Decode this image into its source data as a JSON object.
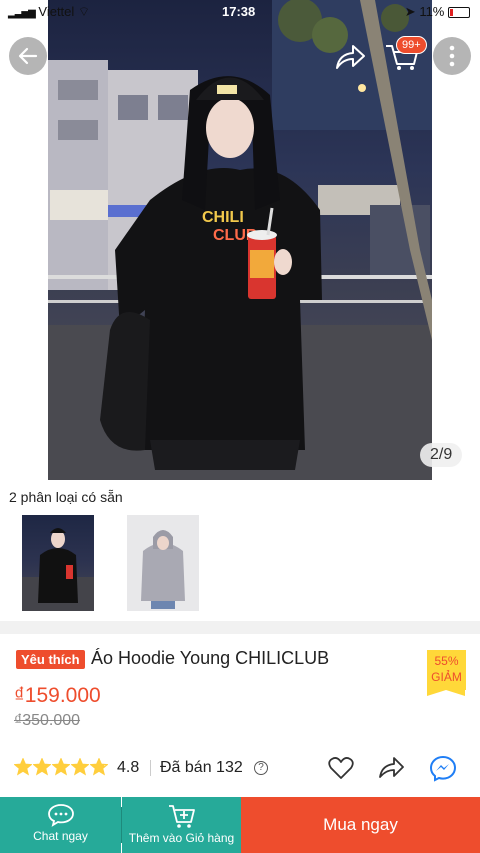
{
  "status_bar": {
    "carrier": "Viettel",
    "time": "17:38",
    "battery": "11%"
  },
  "header": {
    "cart_badge": "99+"
  },
  "gallery": {
    "page_indicator": "2/9"
  },
  "variants": {
    "label": "2 phân loại có sẵn"
  },
  "product": {
    "favorite_badge": "Yêu thích",
    "title": "Áo Hoodie Young CHILICLUB",
    "discount_percent": "55%",
    "discount_label": "GIẢM",
    "price": "₫159.000",
    "old_price": "₫350.000",
    "rating": "4.8",
    "sold": "Đã bán 132",
    "star_rating": 4.8
  },
  "bottom_bar": {
    "chat_label": "Chat ngay",
    "add_to_cart_label": "Thêm vào Giỏ hàng",
    "buy_now_label": "Mua ngay"
  },
  "colors": {
    "accent": "#ee4d2d",
    "teal": "#26aa99",
    "discount_bg": "#ffd839",
    "star": "#ffce3d"
  }
}
